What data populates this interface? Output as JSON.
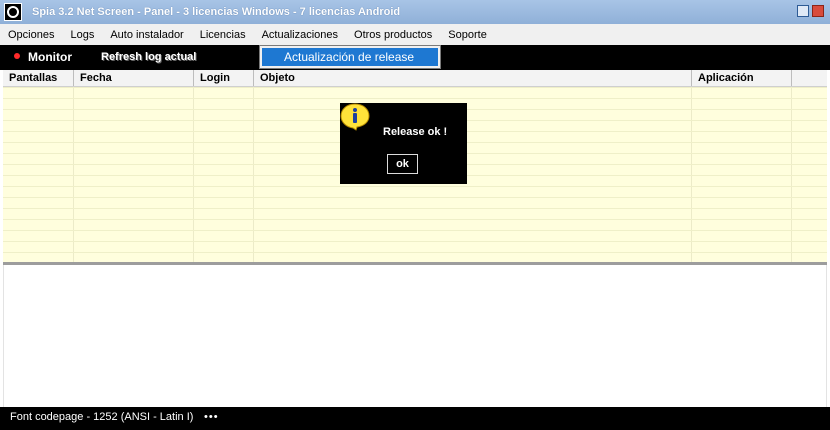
{
  "window": {
    "title": "Spia 3.2 Net Screen   -   Panel   -   3 licencias Windows   -   7 licencias Android"
  },
  "menu": {
    "items": [
      "Opciones",
      "Logs",
      "Auto instalador",
      "Licencias",
      "Actualizaciones",
      "Otros productos",
      "Soporte"
    ]
  },
  "toolbar": {
    "monitor_label": "Monitor",
    "refresh_label": "Refresh log actual"
  },
  "dropdown": {
    "item": "Actualización de release"
  },
  "table": {
    "columns": [
      "Pantallas",
      "Fecha",
      "Login",
      "Objeto",
      "Aplicación"
    ]
  },
  "dialog": {
    "message": "Release ok !",
    "ok_label": "ok",
    "icon": "info-icon"
  },
  "status": {
    "text": "Font codepage - 1252  (ANSI - Latin I)",
    "more": "•••"
  },
  "colors": {
    "title_bar": "#8fb0d8",
    "grid_bg": "#fffedd",
    "menu_highlight": "#1e78d2",
    "monitor_dot": "#ff2a2a"
  }
}
